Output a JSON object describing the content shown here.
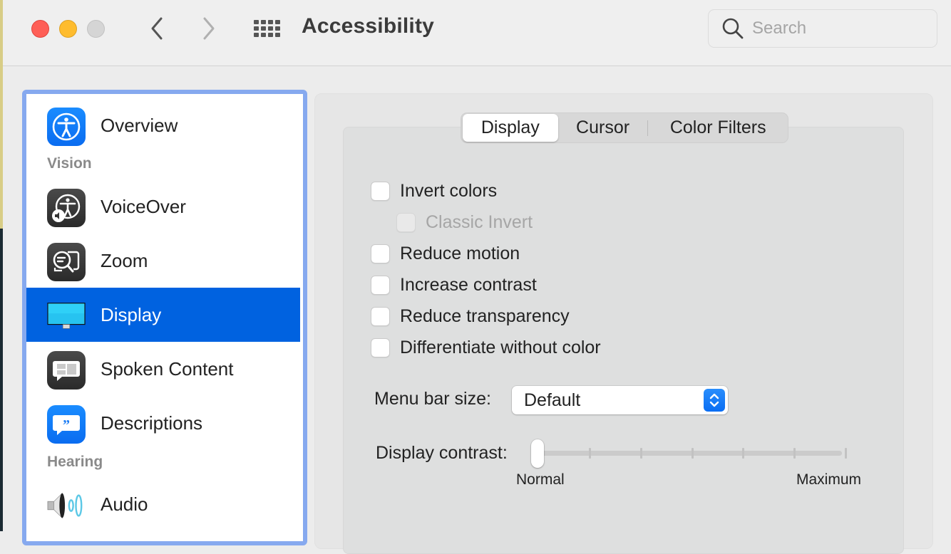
{
  "window": {
    "title": "Accessibility",
    "search_placeholder": "Search",
    "search_value": ""
  },
  "sidebar": {
    "selected": "Display",
    "items": [
      {
        "type": "item",
        "label": "Overview",
        "icon": "accessibility-icon"
      },
      {
        "type": "header",
        "label": "Vision"
      },
      {
        "type": "item",
        "label": "VoiceOver",
        "icon": "voiceover-icon"
      },
      {
        "type": "item",
        "label": "Zoom",
        "icon": "zoom-magnifier-icon"
      },
      {
        "type": "item",
        "label": "Display",
        "icon": "display-monitor-icon"
      },
      {
        "type": "item",
        "label": "Spoken Content",
        "icon": "spoken-content-icon"
      },
      {
        "type": "item",
        "label": "Descriptions",
        "icon": "descriptions-quote-icon"
      },
      {
        "type": "header",
        "label": "Hearing"
      },
      {
        "type": "item",
        "label": "Audio",
        "icon": "speaker-icon"
      }
    ]
  },
  "tabs": {
    "selected": "Display",
    "items": [
      "Display",
      "Cursor",
      "Color Filters"
    ]
  },
  "options": [
    {
      "label": "Invert colors",
      "checked": false,
      "enabled": true
    },
    {
      "label": "Classic Invert",
      "checked": false,
      "enabled": false
    },
    {
      "label": "Reduce motion",
      "checked": false,
      "enabled": true
    },
    {
      "label": "Increase contrast",
      "checked": false,
      "enabled": true
    },
    {
      "label": "Reduce transparency",
      "checked": false,
      "enabled": true
    },
    {
      "label": "Differentiate without color",
      "checked": false,
      "enabled": true
    }
  ],
  "menu_bar_size": {
    "label": "Menu bar size:",
    "value": "Default"
  },
  "display_contrast": {
    "label": "Display contrast:",
    "min_label": "Normal",
    "max_label": "Maximum",
    "value_fraction": 0,
    "tick_count": 7
  },
  "colors": {
    "selection": "#0062e0",
    "sidebar_focus_ring": "#86a9ef",
    "accent": "#0a6ef3",
    "close": "#fe5f57",
    "minimize": "#febc2e",
    "zoom_disabled": "#d5d5d5"
  }
}
